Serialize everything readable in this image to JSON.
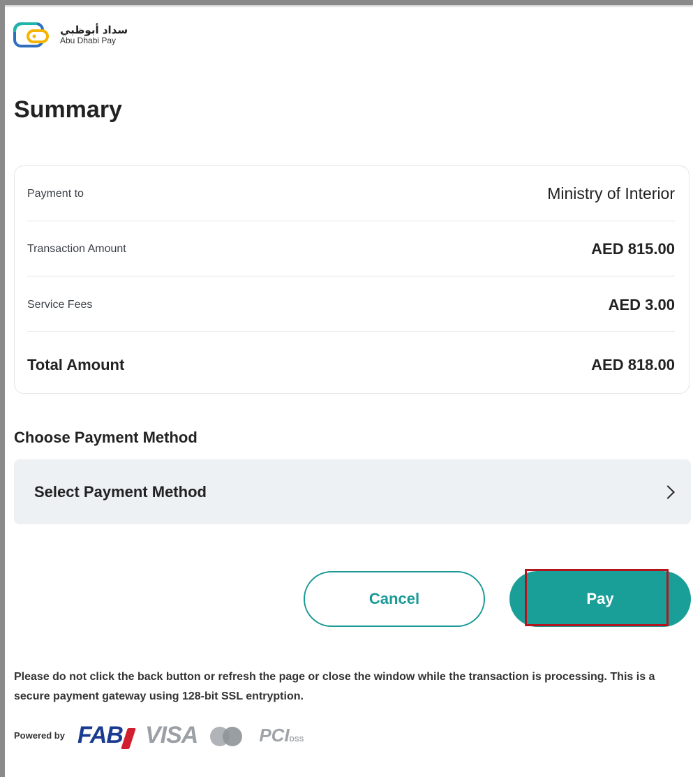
{
  "brand": {
    "arabic_name": "سداد أبوظبي",
    "english_name": "Abu Dhabi Pay",
    "logo_colors": [
      "#f5b400",
      "#1fb5a8",
      "#2f6fbf"
    ]
  },
  "title": "Summary",
  "summary": {
    "rows": [
      {
        "label": "Payment to",
        "value": "Ministry of Interior"
      },
      {
        "label": "Transaction Amount",
        "value": "AED 815.00"
      },
      {
        "label": "Service Fees",
        "value": "AED 3.00"
      }
    ],
    "total": {
      "label": "Total Amount",
      "value": "AED 818.00"
    }
  },
  "payment_method": {
    "heading": "Choose Payment Method",
    "selector_label": "Select Payment Method",
    "icon": "chevron-right-icon"
  },
  "actions": {
    "cancel_label": "Cancel",
    "pay_label": "Pay",
    "accent_color": "#1a9e98",
    "highlight_color": "#b3141e"
  },
  "disclaimer": "Please do not click the back button or refresh the page or close the window while the transaction is processing. This is a secure payment gateway using 128-bit SSL entryption.",
  "footer": {
    "powered_by": "Powered by",
    "logos": {
      "fab": "FAB",
      "visa": "VISA",
      "pci": "PCI",
      "dss": "DSS"
    }
  }
}
